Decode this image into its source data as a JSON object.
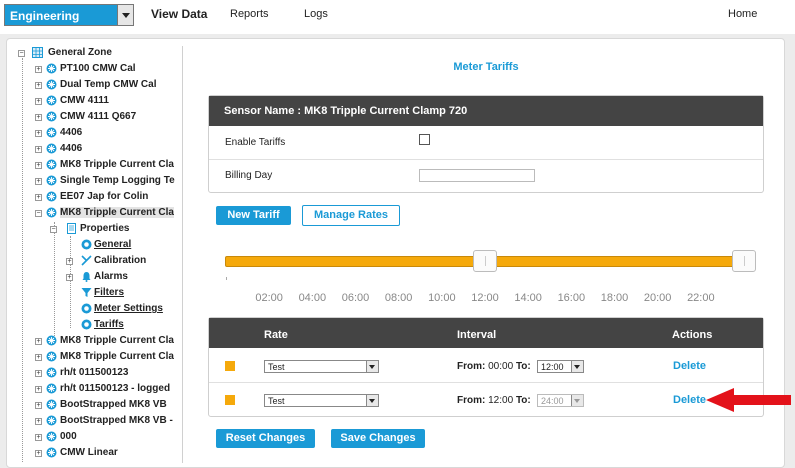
{
  "topbar": {
    "mode": "Engineering",
    "nav": [
      "View Data",
      "Reports",
      "Logs"
    ],
    "home": "Home"
  },
  "tree": {
    "root": "General Zone",
    "sensors_top": [
      "PT100 CMW Cal",
      "Dual Temp CMW Cal",
      "CMW 4111",
      "CMW 4111 Q667",
      "4406",
      "4406",
      "MK8 Tripple Current Cla",
      "Single Temp Logging Te",
      "EE07 Jap for Colin",
      "MK8 Tripple Current Cla"
    ],
    "properties": "Properties",
    "children": [
      "General",
      "Calibration",
      "Alarms",
      "Filters",
      "Meter Settings",
      "Tariffs"
    ],
    "sensors_bottom": [
      "MK8 Tripple Current Cla",
      "MK8 Tripple Current Cla",
      "rh/t 011500123",
      "rh/t 011500123 - logged",
      "BootStrapped MK8 VB",
      "BootStrapped MK8 VB -",
      "000",
      "CMW Linear"
    ]
  },
  "page": {
    "title": "Meter Tariffs"
  },
  "sensor_card": {
    "header": "Sensor Name : MK8 Tripple Current Clamp 720",
    "enable_label": "Enable Tariffs",
    "enable_checked": false,
    "billing_label": "Billing Day",
    "billing_value": ""
  },
  "buttons": {
    "new_tariff": "New Tariff",
    "manage_rates": "Manage Rates",
    "reset": "Reset Changes",
    "save": "Save Changes"
  },
  "slider": {
    "ticks": [
      "02:00",
      "04:00",
      "06:00",
      "08:00",
      "10:00",
      "12:00",
      "14:00",
      "16:00",
      "18:00",
      "20:00",
      "22:00"
    ],
    "handles_hours": [
      12,
      24
    ],
    "color": "#f5a90b"
  },
  "tariff_table": {
    "headers": [
      "Rate",
      "Interval",
      "Actions"
    ],
    "rows": [
      {
        "color": "#f5a90b",
        "rate": "Test",
        "from_label": "From:",
        "from": "00:00",
        "to_label": "To:",
        "to": "12:00",
        "to_disabled": false,
        "action": "Delete"
      },
      {
        "color": "#f5a90b",
        "rate": "Test",
        "from_label": "From:",
        "from": "12:00",
        "to_label": "To:",
        "to": "24:00",
        "to_disabled": true,
        "action": "Delete"
      }
    ]
  },
  "colors": {
    "accent": "#1a9ad6",
    "header_bg": "#444444",
    "annotation_arrow": "#e3121a"
  }
}
